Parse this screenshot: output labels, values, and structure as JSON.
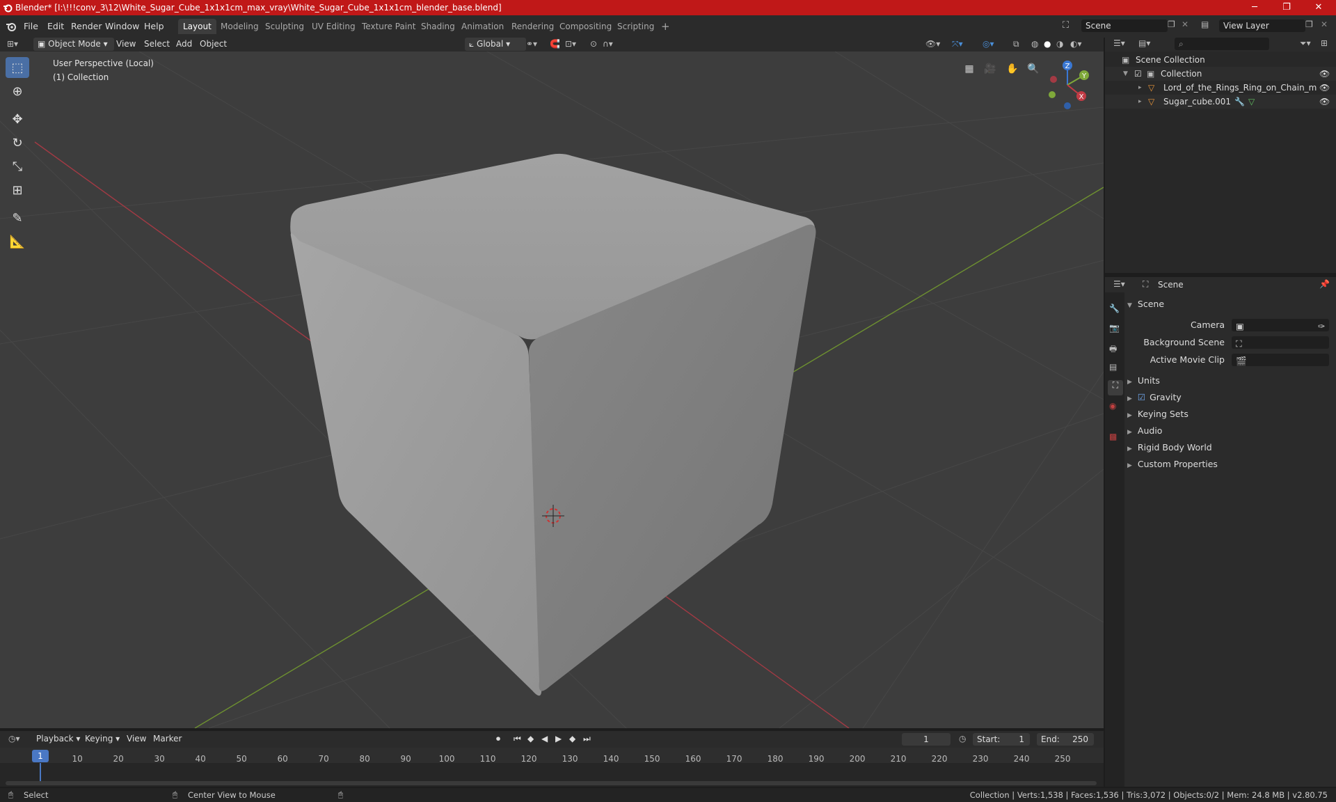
{
  "window": {
    "title": "Blender* [I:\\!!!conv_3\\12\\White_Sugar_Cube_1x1x1cm_max_vray\\White_Sugar_Cube_1x1x1cm_blender_base.blend]",
    "minimize": "─",
    "maximize": "❐",
    "close": "✕"
  },
  "menu": {
    "file": "File",
    "edit": "Edit",
    "render": "Render",
    "window": "Window",
    "help": "Help"
  },
  "workspaces": [
    "Layout",
    "Modeling",
    "Sculpting",
    "UV Editing",
    "Texture Paint",
    "Shading",
    "Animation",
    "Rendering",
    "Compositing",
    "Scripting"
  ],
  "add_workspace": "+",
  "scene_field": "Scene",
  "viewlayer_field": "View Layer",
  "viewport_header": {
    "mode": "Object Mode",
    "view": "View",
    "select": "Select",
    "add": "Add",
    "object": "Object",
    "orientation": "Global"
  },
  "viewport": {
    "perspective": "User Perspective (Local)",
    "collection": "(1) Collection",
    "gizmo": {
      "x": "X",
      "y": "Y",
      "z": "Z"
    }
  },
  "outliner": {
    "search_placeholder": "",
    "scene_collection": "Scene Collection",
    "collection": "Collection",
    "items": [
      "Lord_of_the_Rings_Ring_on_Chain_max_com",
      "Sugar_cube.001"
    ]
  },
  "properties": {
    "header": "Scene",
    "panel": "Scene",
    "camera_label": "Camera",
    "background_scene_label": "Background Scene",
    "active_movie_clip_label": "Active Movie Clip",
    "sections": [
      "Units",
      "Gravity",
      "Keying Sets",
      "Audio",
      "Rigid Body World",
      "Custom Properties"
    ],
    "gravity_checked": true
  },
  "timeline": {
    "playback": "Playback",
    "keying": "Keying",
    "view": "View",
    "marker": "Marker",
    "current_frame": "1",
    "start_label": "Start:",
    "start": "1",
    "end_label": "End:",
    "end": "250",
    "ticks": [
      "1",
      "10",
      "20",
      "30",
      "40",
      "50",
      "60",
      "70",
      "80",
      "90",
      "100",
      "110",
      "120",
      "130",
      "140",
      "150",
      "160",
      "170",
      "180",
      "190",
      "200",
      "210",
      "220",
      "230",
      "240",
      "250"
    ]
  },
  "status": {
    "select": "Select",
    "center_view": "Center View to Mouse",
    "info": "Collection | Verts:1,538 | Faces:1,536 | Tris:3,072 | Objects:0/2 | Mem: 24.8 MB | v2.80.75"
  },
  "colors": {
    "titlebar": "#c01818",
    "accent": "#4a6fa5",
    "x_axis": "#c23b45",
    "y_axis": "#7fa83a",
    "z_axis": "#3a78d4"
  }
}
